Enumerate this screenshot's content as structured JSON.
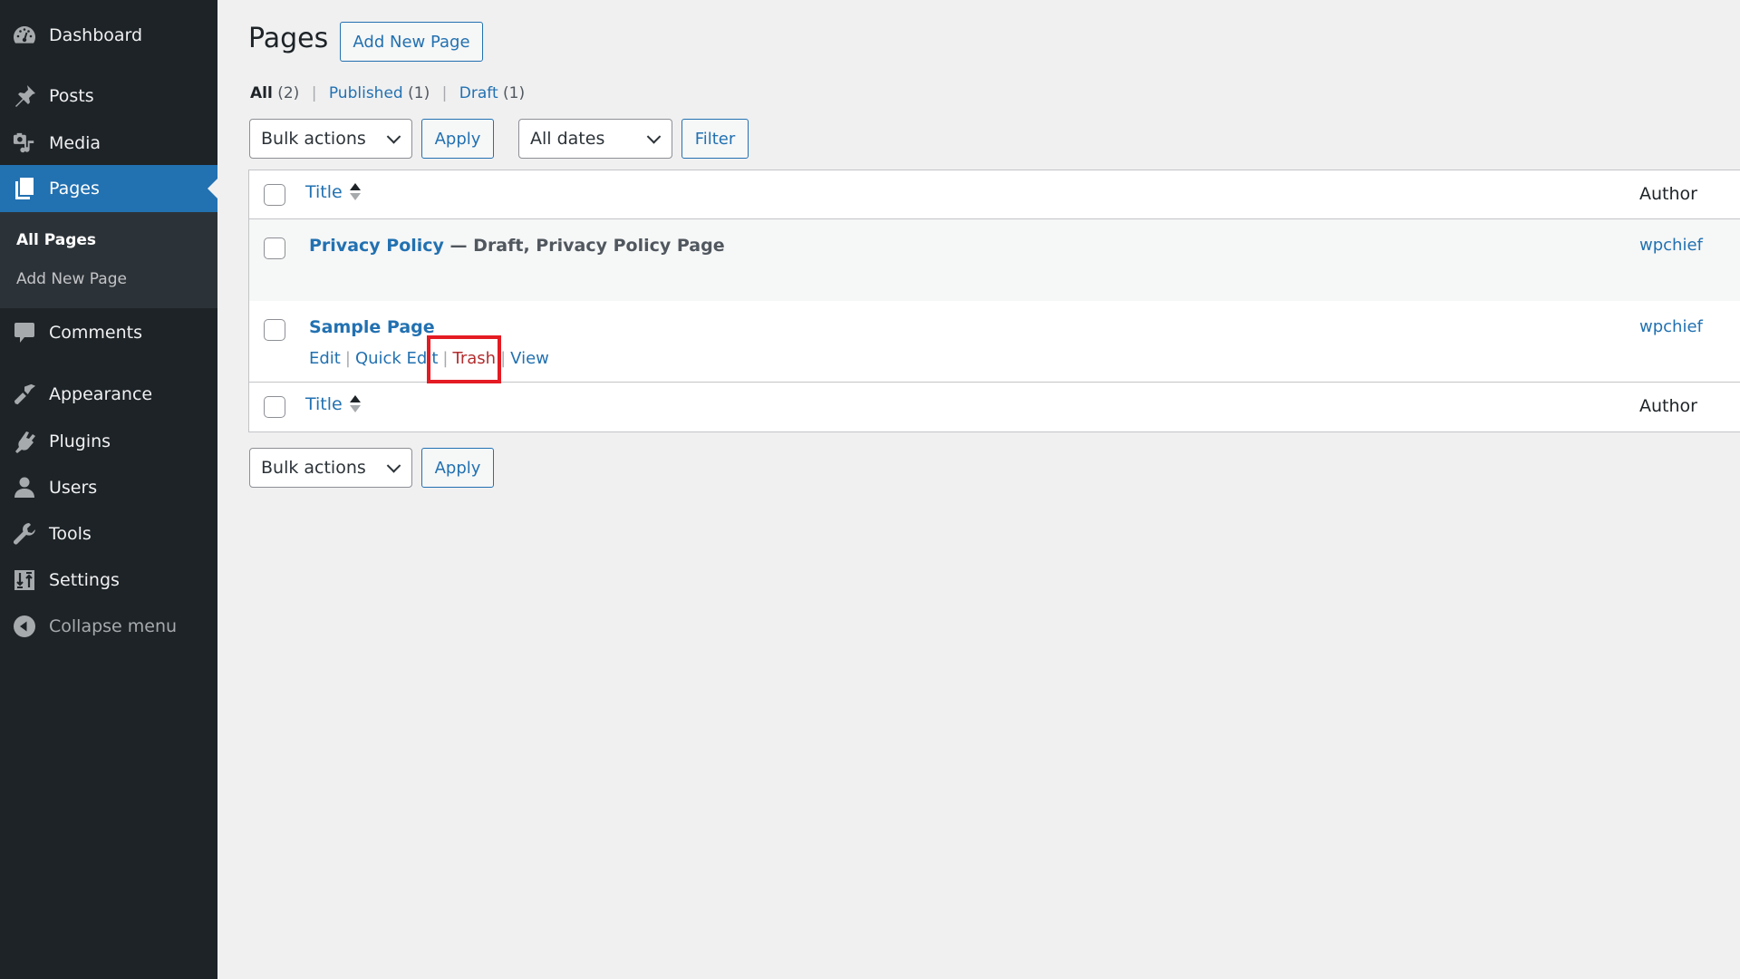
{
  "sidebar": {
    "items": [
      {
        "label": "Dashboard",
        "icon": "dashboard-icon"
      },
      {
        "label": "Posts",
        "icon": "pin-icon"
      },
      {
        "label": "Media",
        "icon": "media-icon"
      },
      {
        "label": "Pages",
        "icon": "pages-icon",
        "active": true
      },
      {
        "label": "Comments",
        "icon": "comment-icon"
      },
      {
        "label": "Appearance",
        "icon": "paintbrush-icon"
      },
      {
        "label": "Plugins",
        "icon": "plug-icon"
      },
      {
        "label": "Users",
        "icon": "user-icon"
      },
      {
        "label": "Tools",
        "icon": "wrench-icon"
      },
      {
        "label": "Settings",
        "icon": "sliders-icon"
      },
      {
        "label": "Collapse menu",
        "icon": "collapse-icon"
      }
    ],
    "submenu": [
      {
        "label": "All Pages",
        "current": true
      },
      {
        "label": "Add New Page"
      }
    ]
  },
  "header": {
    "title": "Pages",
    "add_new_label": "Add New Page"
  },
  "filters": {
    "views": [
      {
        "label": "All",
        "count": "(2)",
        "current": true
      },
      {
        "label": "Published",
        "count": "(1)"
      },
      {
        "label": "Draft",
        "count": "(1)"
      }
    ],
    "separator": "|",
    "bulk_actions": "Bulk actions",
    "apply_label": "Apply",
    "dates": "All dates",
    "filter_label": "Filter"
  },
  "table": {
    "columns": {
      "title": "Title",
      "author": "Author"
    },
    "rows": [
      {
        "title": "Privacy Policy",
        "state": " — Draft, Privacy Policy Page",
        "author": "wpchief"
      },
      {
        "title": "Sample Page",
        "state": "",
        "author": "wpchief",
        "actions": [
          "Edit",
          "Quick Edit",
          "Trash",
          "View"
        ]
      }
    ]
  },
  "bottom": {
    "bulk_actions": "Bulk actions",
    "apply_label": "Apply"
  },
  "colors": {
    "sidebar_bg": "#1d2327",
    "submenu_bg": "#2c3338",
    "accent": "#2271b1",
    "trash": "#b32d2e",
    "highlight": "#e41b23"
  }
}
